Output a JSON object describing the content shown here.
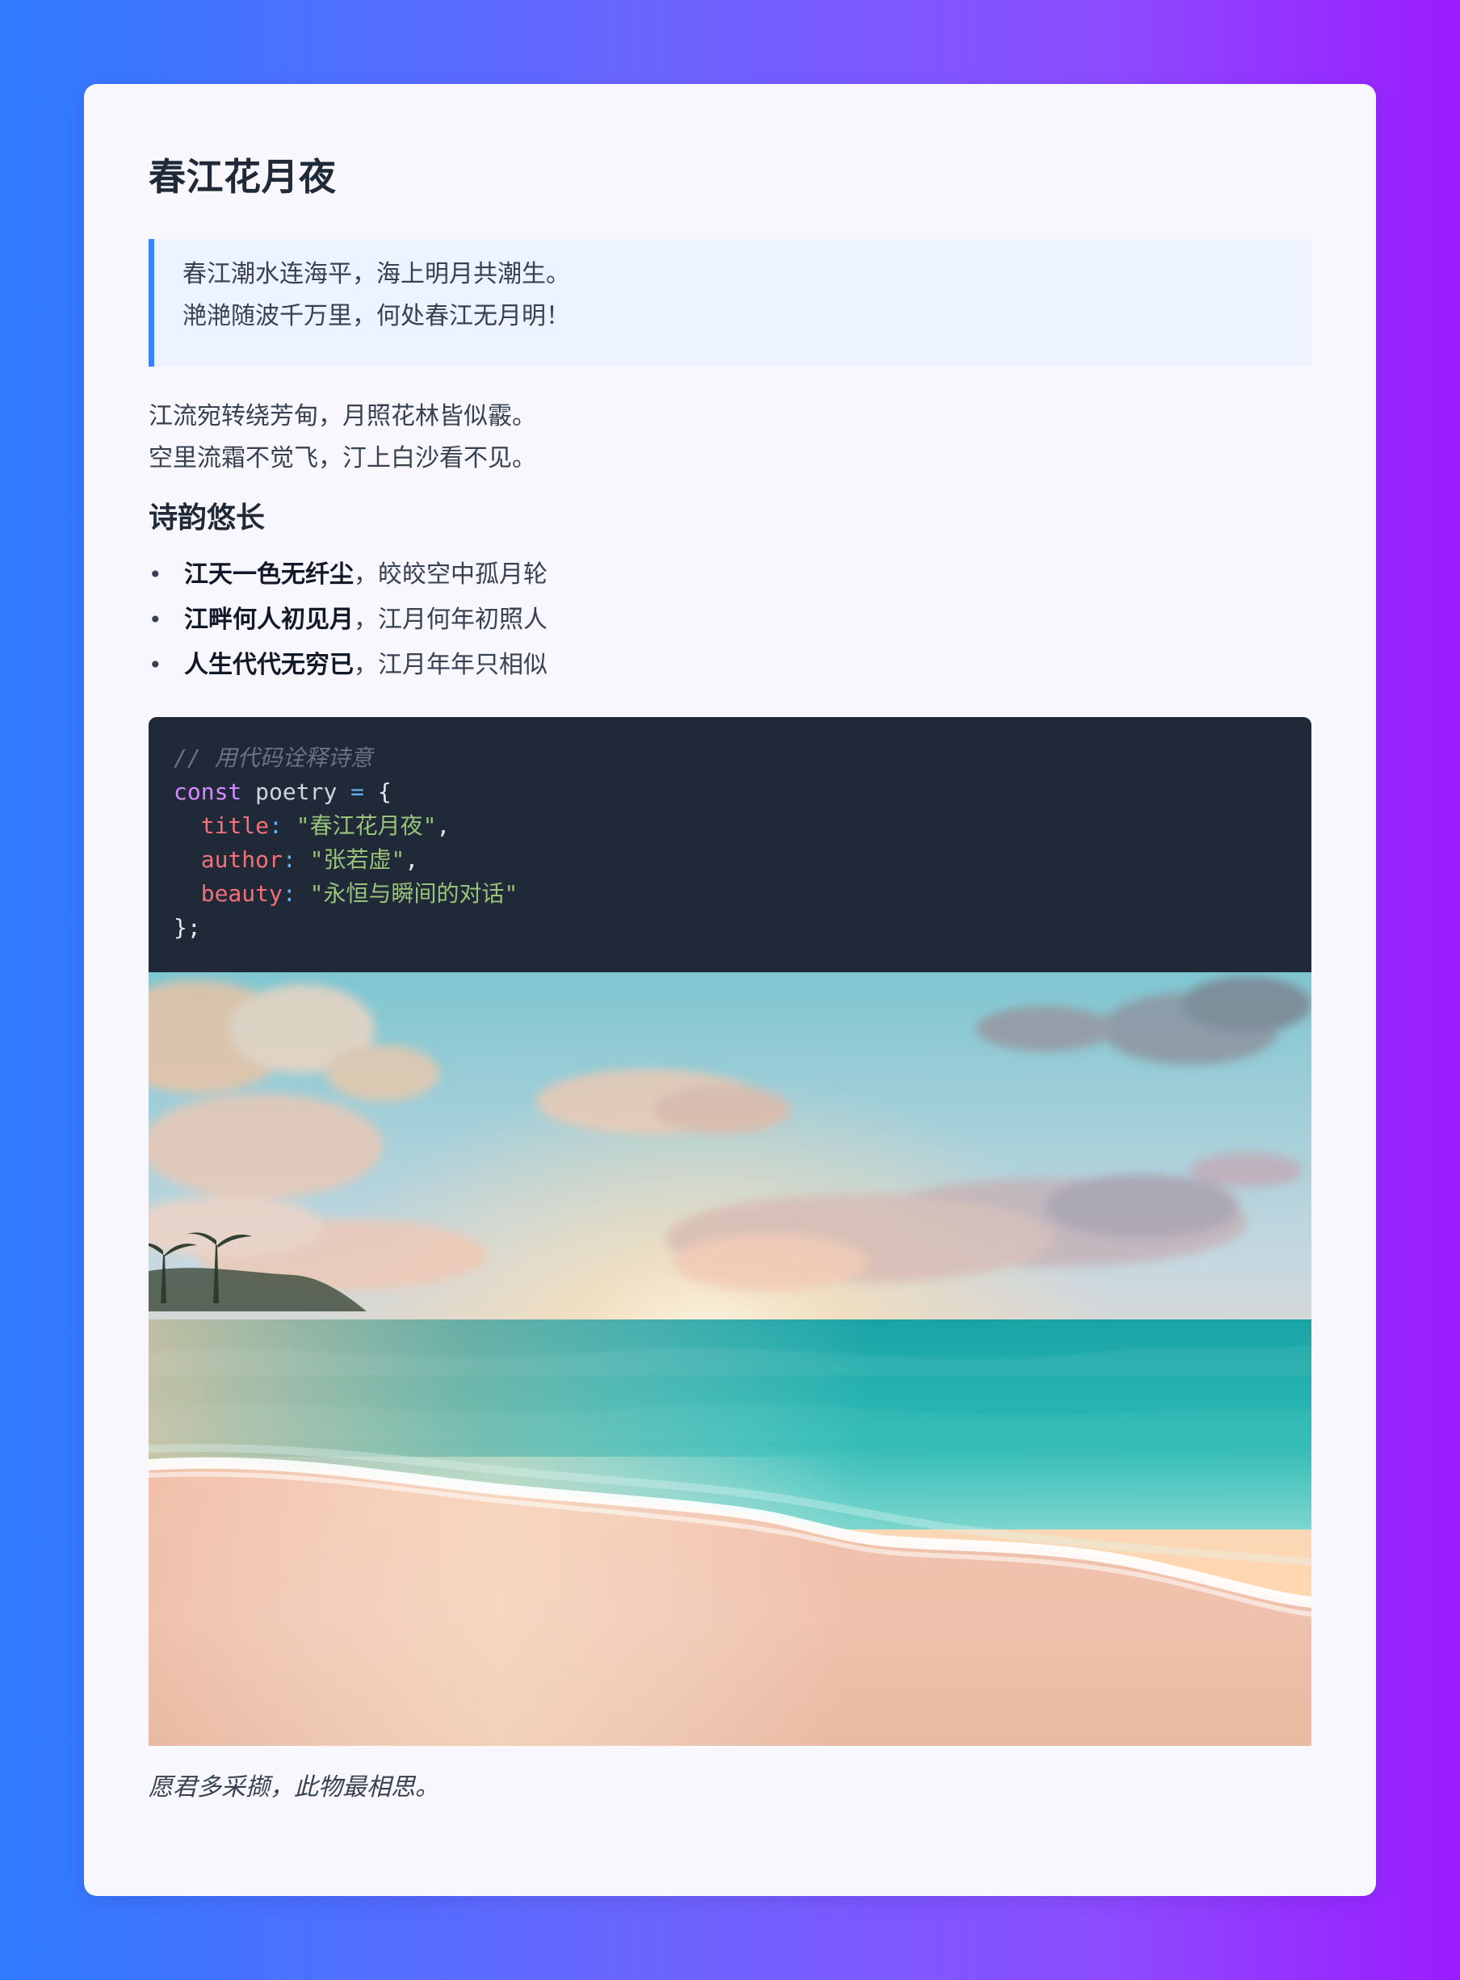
{
  "page": {
    "title": "春江花月夜",
    "quote_lines": [
      "春江潮水连海平，海上明月共潮生。",
      "滟滟随波千万里，何处春江无月明！"
    ],
    "poem_lines": [
      "江流宛转绕芳甸，月照花林皆似霰。",
      "空里流霜不觉飞，汀上白沙看不见。"
    ],
    "section_title": "诗韵悠长",
    "list_items": [
      {
        "strong": "江天一色无纤尘",
        "rest": "，皎皎空中孤月轮"
      },
      {
        "strong": "江畔何人初见月",
        "rest": "，江月何年初照人"
      },
      {
        "strong": "人生代代无穷已",
        "rest": "，江月年年只相似"
      }
    ],
    "code": {
      "comment": "// 用代码诠释诗意",
      "keyword": "const",
      "ident": "poetry",
      "assign": "=",
      "open": "{",
      "props": [
        {
          "key": "title",
          "value": "\"春江花月夜\""
        },
        {
          "key": "author",
          "value": "\"张若虚\""
        },
        {
          "key": "beauty",
          "value": "\"永恒与瞬间的对话\""
        }
      ],
      "close": "};"
    },
    "caption": "愿君多采撷，此物最相思。"
  }
}
